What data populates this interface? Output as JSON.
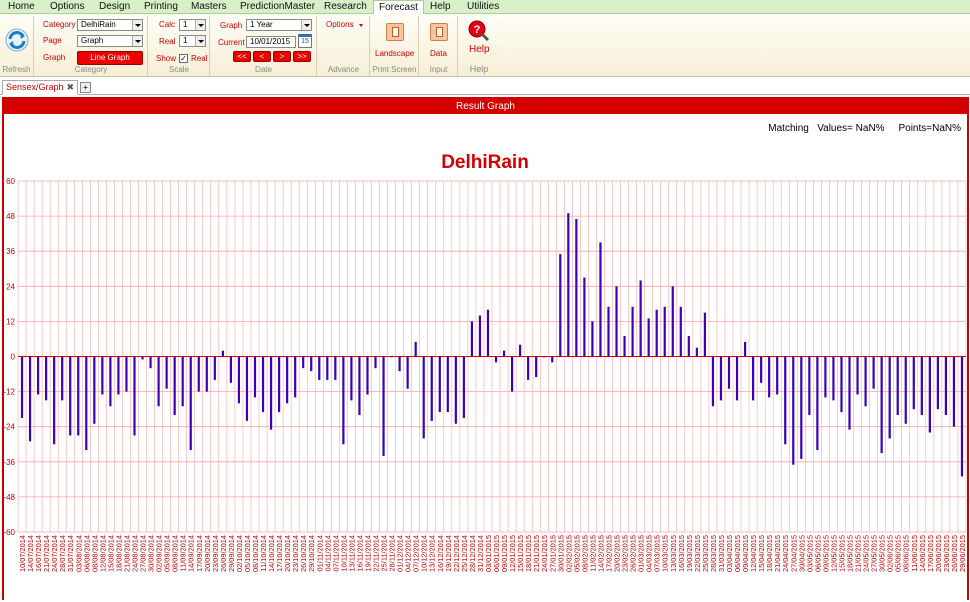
{
  "menu": {
    "items": [
      "Home",
      "Options",
      "Design",
      "Printing",
      "Masters",
      "PredictionMaster",
      "Research",
      "Forecast",
      "Help",
      "Utilities"
    ],
    "active": "Forecast"
  },
  "ribbon": {
    "refresh": {
      "group_label": "Refresh"
    },
    "category": {
      "category_label": "Category",
      "category_value": "DelhiRain",
      "page_label": "Page",
      "page_value": "Graph",
      "graph_label": "Graph",
      "graph_button": "Line Graph",
      "group_label": "Category"
    },
    "scale": {
      "calc_label": "Calc",
      "calc_value": "1",
      "real_label": "Real",
      "real_value": "1",
      "show_label": "Show",
      "show_checked": "✓",
      "show_real_label": "Real",
      "group_label": "Scale"
    },
    "date": {
      "graph_label": "Graph",
      "graph_value": "1 Year",
      "current_label": "Current",
      "current_value": "10/01/2015",
      "calendar_day": "15",
      "nav": [
        "<<",
        "<",
        ">",
        ">>"
      ],
      "group_label": "Date"
    },
    "advance": {
      "options_label": "Options",
      "group_label": "Advance"
    },
    "print": {
      "landscape_label": "Landscape",
      "group_label": "Print Screen"
    },
    "input": {
      "data_label": "Data",
      "group_label": "Input"
    },
    "help": {
      "help_label": "Help",
      "group_label": "Help"
    }
  },
  "tabs": {
    "active": "Sensex/Graph",
    "close": "✖",
    "add": "+"
  },
  "result": {
    "title": "Result Graph",
    "matching_label": "Matching",
    "values_text": "Values= NaN%",
    "points_text": "Points=NaN%"
  },
  "colors": {
    "bar": "#3b00b8",
    "grid": "#f4a6a6",
    "axis_text": "#c00000",
    "title": "#d40000"
  },
  "chart_data": {
    "type": "bar",
    "title": "DelhiRain",
    "ylim": [
      -60,
      60
    ],
    "yticks": [
      60,
      48,
      36,
      24,
      12,
      0,
      -12,
      -24,
      -36,
      -48,
      -60
    ],
    "grid": true,
    "x": [
      "10/07/2014",
      "14/07/2014",
      "16/07/2014",
      "21/07/2014",
      "24/07/2014",
      "28/07/2014",
      "31/07/2014",
      "03/08/2014",
      "06/08/2014",
      "08/08/2014",
      "12/08/2014",
      "15/08/2014",
      "18/08/2014",
      "21/08/2014",
      "24/08/2014",
      "27/08/2014",
      "30/08/2014",
      "02/09/2014",
      "05/09/2014",
      "08/09/2014",
      "11/09/2014",
      "14/09/2014",
      "17/09/2014",
      "20/09/2014",
      "23/09/2014",
      "26/09/2014",
      "29/09/2014",
      "02/10/2014",
      "05/10/2014",
      "08/10/2014",
      "11/10/2014",
      "14/10/2014",
      "17/10/2014",
      "20/10/2014",
      "23/10/2014",
      "26/10/2014",
      "29/10/2014",
      "01/11/2014",
      "04/11/2014",
      "07/11/2014",
      "10/11/2014",
      "13/11/2014",
      "16/11/2014",
      "19/11/2014",
      "22/11/2014",
      "25/11/2014",
      "28/11/2014",
      "01/12/2014",
      "04/12/2014",
      "07/12/2014",
      "10/12/2014",
      "13/12/2014",
      "16/12/2014",
      "19/12/2014",
      "22/12/2014",
      "25/12/2014",
      "28/12/2014",
      "31/12/2014",
      "03/01/2015",
      "06/01/2015",
      "09/01/2015",
      "12/01/2015",
      "15/01/2015",
      "18/01/2015",
      "21/01/2015",
      "24/01/2015",
      "27/01/2015",
      "30/01/2015",
      "02/02/2015",
      "05/02/2015",
      "08/02/2015",
      "11/02/2015",
      "14/02/2015",
      "17/02/2015",
      "20/02/2015",
      "23/02/2015",
      "26/02/2015",
      "01/03/2015",
      "04/03/2015",
      "07/03/2015",
      "10/03/2015",
      "13/03/2015",
      "16/03/2015",
      "19/03/2015",
      "22/03/2015",
      "25/03/2015",
      "28/03/2015",
      "31/03/2015",
      "03/04/2015",
      "06/04/2015",
      "09/04/2015",
      "12/04/2015",
      "15/04/2015",
      "18/04/2015",
      "21/04/2015",
      "24/04/2015",
      "27/04/2015",
      "30/04/2015",
      "03/05/2015",
      "06/05/2015",
      "09/05/2015",
      "12/05/2015",
      "15/05/2015",
      "18/05/2015",
      "21/05/2015",
      "24/05/2015",
      "27/05/2015",
      "30/05/2015",
      "02/06/2015",
      "05/06/2015",
      "08/06/2015",
      "11/06/2015",
      "14/06/2015",
      "17/06/2015",
      "20/06/2015",
      "23/06/2015",
      "26/06/2015",
      "29/06/2015",
      "02/07/2015",
      "05/07/2015"
    ],
    "values": [
      -21,
      -29,
      -13,
      -15,
      -30,
      -15,
      -27,
      -27,
      -32,
      -23,
      -13,
      -17,
      -13,
      -12,
      -27,
      -1,
      -4,
      -17,
      -11,
      -20,
      -17,
      -32,
      -12,
      -12,
      -8,
      2,
      -9,
      -16,
      -22,
      -14,
      -19,
      -25,
      -19,
      -16,
      -14,
      -4,
      -5,
      -8,
      -8,
      -8,
      -30,
      -15,
      -20,
      -13,
      -4,
      -34,
      0,
      -5,
      -11,
      5,
      -28,
      -22,
      -19,
      -19,
      -23,
      -21,
      12,
      14,
      16,
      -2,
      2,
      -12,
      4,
      -8,
      -7,
      0,
      -2,
      35,
      49,
      47,
      27,
      12,
      39,
      17,
      24,
      7,
      17,
      26,
      13,
      16,
      17,
      24,
      17,
      7,
      3,
      15,
      -17,
      -15,
      -11,
      -15,
      5,
      -15,
      -9,
      -14,
      -13,
      -30,
      -37,
      -35,
      -20,
      -32,
      -14,
      -15,
      -19,
      -25,
      -13,
      -17,
      -11,
      -33,
      -28,
      -20,
      -23,
      -18,
      -20,
      -26,
      -18,
      -20,
      -24,
      -41
    ]
  }
}
